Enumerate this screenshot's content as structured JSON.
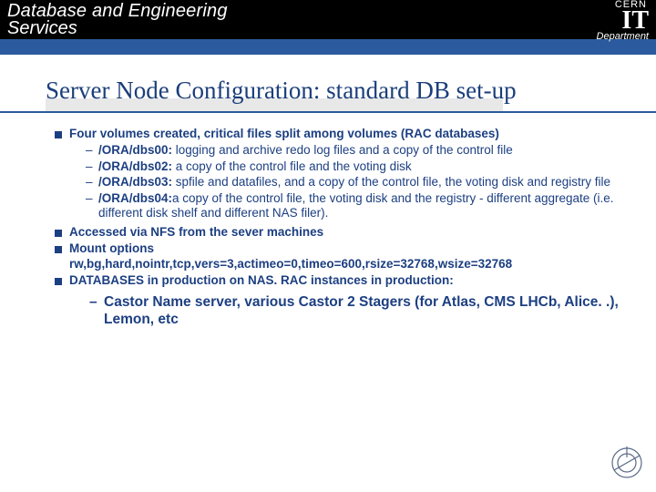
{
  "header": {
    "service_line1": "Database and Engineering",
    "service_line2": "Services",
    "org": "CERN",
    "dept_abbr": "IT",
    "dept_word": "Department"
  },
  "title": "Server Node Configuration: standard DB set-up",
  "bullets": {
    "b1": "Four volumes created, critical files split among volumes (RAC databases)",
    "b1_subs": {
      "s1a": "/ORA/dbs00:",
      "s1b": "logging and archive redo log files and a copy of the control file",
      "s2a": "/ORA/dbs02:",
      "s2b": "a copy of the control file and the voting disk",
      "s3a": "/ORA/dbs03:",
      "s3b": "spfile and datafiles, and a copy of the control file, the voting disk and registry file",
      "s4a": "/ORA/dbs04:",
      "s4b": "a copy of the control file, the voting disk and the registry - different aggregate (i.e. different disk shelf and different NAS filer)."
    },
    "b2": "Accessed via NFS from the sever machines",
    "b3_label": "Mount  options",
    "b3_opts": "rw,bg,hard,nointr,tcp,vers=3,actimeo=0,timeo=600,rsize=32768,wsize=32768",
    "b4": "DATABASES in production on NAS. RAC instances in production:",
    "b4_sub": "Castor  Name server, various Castor 2 Stagers (for Atlas, CMS LHCb, Alice. .), Lemon, etc"
  }
}
